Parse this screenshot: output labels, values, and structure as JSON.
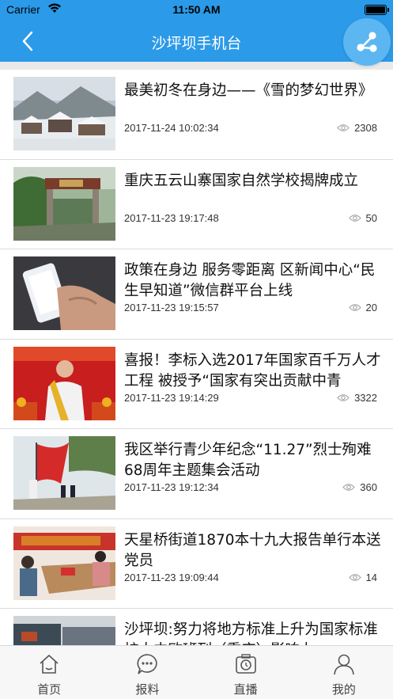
{
  "status_bar": {
    "carrier": "Carrier",
    "time": "11:50 AM"
  },
  "header": {
    "title": "沙坪坝手机台",
    "back_icon": "chevron-left-icon",
    "share_icon": "share-icon"
  },
  "colors": {
    "primary": "#2b9ae8",
    "share_bg": "#5cb6f2",
    "divider": "#e9e9e9",
    "text": "#111111",
    "tab_text": "#444444"
  },
  "news": [
    {
      "title": "最美初冬在身边——《雪的梦幻世界》",
      "date": "2017-11-24 10:02:34",
      "views": "2308",
      "thumb": "snow-village-photo"
    },
    {
      "title": "重庆五云山寨国家自然学校揭牌成立",
      "date": "2017-11-23 19:17:48",
      "views": "50",
      "thumb": "school-gate-photo"
    },
    {
      "title": "政策在身边 服务零距离 区新闻中心“民生早知道”微信群平台上线",
      "date": "2017-11-23 19:15:57",
      "views": "20",
      "thumb": "phone-hand-photo"
    },
    {
      "title": "喜报！李标入选2017年国家百千万人才工程 被授予“国家有突出贡献中青",
      "date": "2017-11-23 19:14:29",
      "views": "3322",
      "thumb": "award-man-photo"
    },
    {
      "title": "我区举行青少年纪念“11.27”烈士殉难68周年主题集会活动",
      "date": "2017-11-23 19:12:34",
      "views": "360",
      "thumb": "flag-ceremony-photo"
    },
    {
      "title": "天星桥街道1870本十九大报告单行本送党员",
      "date": "2017-11-23 19:09:44",
      "views": "14",
      "thumb": "meeting-room-photo"
    },
    {
      "title": "沙坪坝:努力将地方标准上升为国家标准 扩大中欧班列（重庆）影响力",
      "date": "",
      "views": "",
      "thumb": "train-container-photo"
    }
  ],
  "tabs": [
    {
      "label": "首页",
      "icon": "home-icon"
    },
    {
      "label": "报料",
      "icon": "chat-bubble-icon"
    },
    {
      "label": "直播",
      "icon": "camera-live-icon"
    },
    {
      "label": "我的",
      "icon": "user-icon"
    }
  ]
}
